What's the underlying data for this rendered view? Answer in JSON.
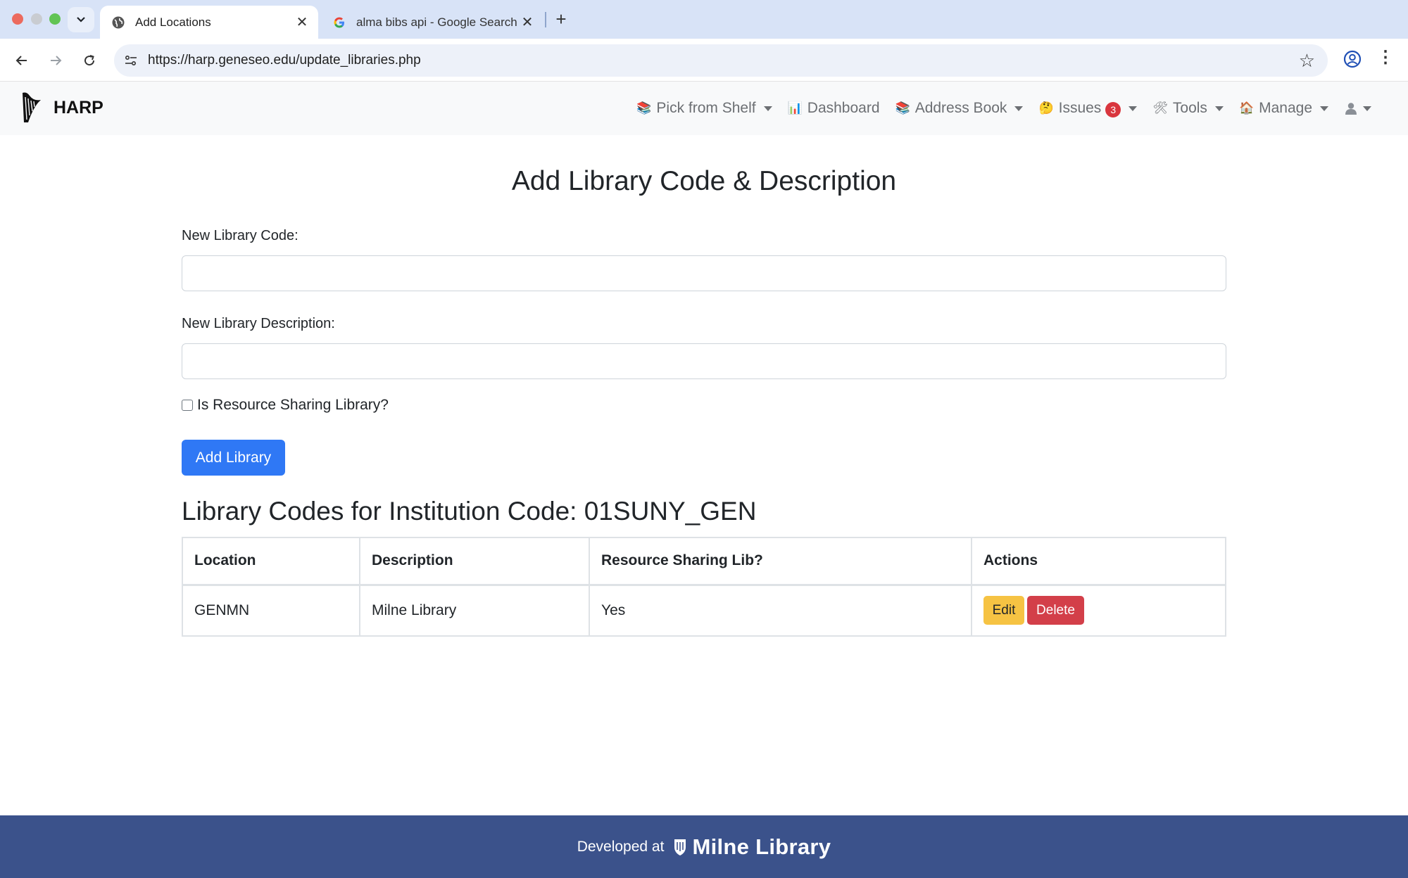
{
  "browser": {
    "tabs": [
      {
        "title": "Add Locations",
        "active": true
      },
      {
        "title": "alma bibs api - Google Search",
        "active": false
      }
    ],
    "url": "https://harp.geneseo.edu/update_libraries.php"
  },
  "app": {
    "brand": "HARP",
    "nav": [
      {
        "label": "Pick from Shelf",
        "icon": "books-icon",
        "dropdown": true
      },
      {
        "label": "Dashboard",
        "icon": "bar-chart-icon",
        "dropdown": false
      },
      {
        "label": "Address Book",
        "icon": "books-icon",
        "dropdown": true
      },
      {
        "label": "Issues",
        "icon": "thinking-face-icon",
        "dropdown": true,
        "badge": "3"
      },
      {
        "label": "Tools",
        "icon": "tools-icon",
        "dropdown": true
      },
      {
        "label": "Manage",
        "icon": "house-icon",
        "dropdown": true
      },
      {
        "label": "",
        "icon": "user-icon",
        "dropdown": true
      }
    ]
  },
  "main": {
    "title": "Add Library Code & Description",
    "code_label": "New Library Code:",
    "code_value": "",
    "desc_label": "New Library Description:",
    "desc_value": "",
    "rs_checkbox_label": "Is Resource Sharing Library?",
    "rs_checked": false,
    "submit_label": "Add Library",
    "section_title": "Library Codes for Institution Code: 01SUNY_GEN",
    "table": {
      "headers": [
        "Location",
        "Description",
        "Resource Sharing Lib?",
        "Actions"
      ],
      "rows": [
        {
          "location": "GENMN",
          "description": "Milne Library",
          "resource_sharing": "Yes",
          "edit": "Edit",
          "delete": "Delete"
        }
      ]
    }
  },
  "footer": {
    "text": "Developed at",
    "logo_text": "Milne Library"
  },
  "colors": {
    "primary": "#2f78f5",
    "warning": "#f6c343",
    "danger": "#d33f49",
    "footer": "#3b528b",
    "navbar": "#f8f9fa"
  }
}
